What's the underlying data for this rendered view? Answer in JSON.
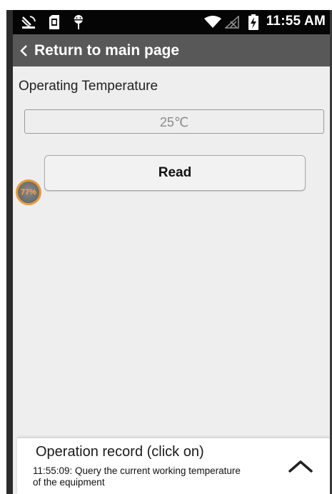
{
  "status_bar": {
    "time": "11:55 AM",
    "icons": [
      "satellite-dish-icon",
      "sim-card-icon",
      "android-icon",
      "wifi-icon",
      "no-signal-icon",
      "battery-charging-icon"
    ]
  },
  "nav": {
    "back_icon": "chevron-left-icon",
    "title": "Return to main page"
  },
  "main": {
    "section_label": "Operating Temperature",
    "temperature_value": "25℃",
    "read_button_label": "Read"
  },
  "floating_badge": {
    "text": "77%"
  },
  "record_panel": {
    "title": "Operation record (click on)",
    "entry": "11:55:09: Query the current working temperature of the equipment",
    "expand_icon": "chevron-up-icon"
  },
  "colors": {
    "status_bar_bg": "#050505",
    "nav_bar_bg": "#585858",
    "screen_bg": "#eeeeee",
    "badge_accent": "#e69b3a"
  }
}
